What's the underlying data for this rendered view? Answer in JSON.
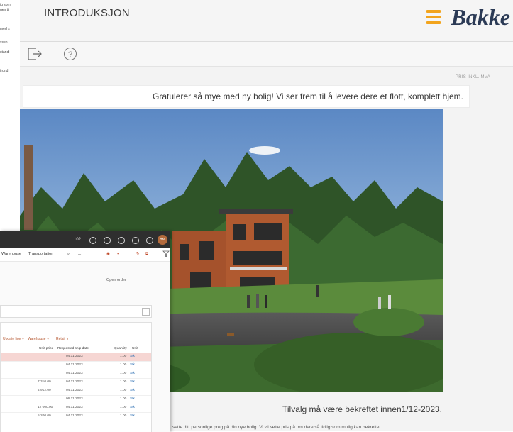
{
  "left_doc": {
    "lines": [
      "ig som",
      "gen ti",
      "",
      "med s",
      "",
      "ssen.",
      "standi",
      "",
      "trond"
    ]
  },
  "header": {
    "title": "INTRODUKSJON",
    "brand_name": "Bakke",
    "brand_color": "#f2a41d"
  },
  "toolbar": {
    "icons": [
      "exit-icon",
      "help-icon"
    ],
    "help_glyph": "?"
  },
  "content": {
    "price_note": "PRIS INKL. MVA",
    "greeting": "Gratulerer så mye med ny bolig! Vi ser frem til å levere dere et flott, komplett hjem.",
    "deadline": "Tilvalg må være bekreftet innen1/12-2023.",
    "body_text": "sette ditt personlige preg på din nye bolig. Vi vil sette pris på om dere så tidlig som mulig kan bekrefte"
  },
  "overlay": {
    "topbar_number": "102",
    "avatar": "BM",
    "menu": [
      "Warehouse",
      "Transportation"
    ],
    "menu_more": "...",
    "open_order": "Open order",
    "tabs": [
      "Update line ∨",
      "Warehouse ∨",
      "Retail ∨"
    ],
    "columns": [
      "Unit price",
      "Requested ship date",
      "Quantity",
      "Unit"
    ],
    "rows": [
      {
        "price": "",
        "date": "04.11.2023",
        "qty": "1.00",
        "unit": "Stk",
        "highlight": true
      },
      {
        "price": "",
        "date": "04.11.2023",
        "qty": "1.00",
        "unit": "Stk"
      },
      {
        "price": "",
        "date": "04.11.2023",
        "qty": "1.00",
        "unit": "Stk"
      },
      {
        "price": "7 310.00",
        "date": "04.11.2023",
        "qty": "1.00",
        "unit": "Stk"
      },
      {
        "price": "4 912.00",
        "date": "04.11.2023",
        "qty": "1.00",
        "unit": "Stk"
      },
      {
        "price": "",
        "date": "06.11.2023",
        "qty": "1.00",
        "unit": "Stk"
      },
      {
        "price": "12 000.00",
        "date": "04.11.2023",
        "qty": "1.00",
        "unit": "Stk"
      },
      {
        "price": "5 200.00",
        "date": "04.11.2023",
        "qty": "1.00",
        "unit": "Stk"
      }
    ]
  }
}
